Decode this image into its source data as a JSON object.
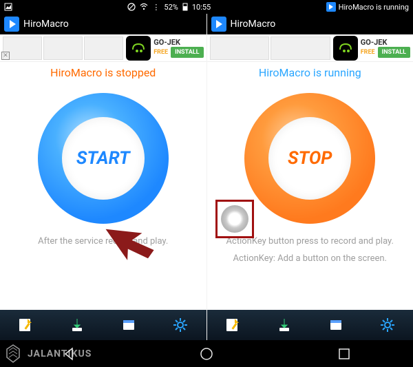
{
  "status_bar": {
    "battery_pct": "52%",
    "time": "10:55",
    "notification_text": "HiroMacro is running"
  },
  "panes": [
    {
      "app_title": "HiroMacro",
      "status_text": "HiroMacro is stopped",
      "button_label": "START",
      "hint1": "After the service record and play."
    },
    {
      "app_title": "HiroMacro",
      "status_text": "HiroMacro is running",
      "button_label": "STOP",
      "hint1": "ActionKey button press to record and play.",
      "hint2": "ActionKey: Add a button on the screen."
    }
  ],
  "ad": {
    "name": "GO-JEK",
    "free_label": "FREE",
    "install_label": "INSTALL"
  },
  "watermark": "JALANTIKUS"
}
